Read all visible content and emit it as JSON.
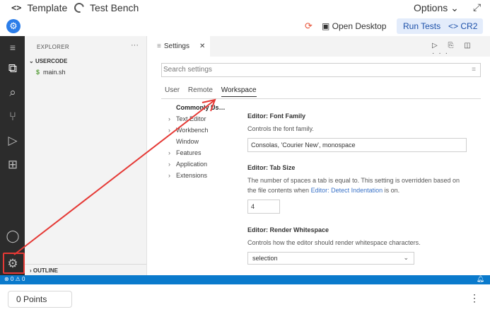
{
  "titlebar": {
    "code_glyph": "<>",
    "template_label": "Template",
    "testbench_label": "Test Bench",
    "options_label": "Options ⌄",
    "expand_glyph": "⤢"
  },
  "toolbar": {
    "open_desktop_label": "Open Desktop",
    "run_tests_label": "Run Tests",
    "cr2_label": "CR2",
    "cr2_glyph": "<>"
  },
  "explorer": {
    "title": "EXPLORER",
    "more": "···",
    "folder": "USERCODE",
    "file": "main.sh",
    "file_icon": "$",
    "outline": "OUTLINE"
  },
  "editor": {
    "tab_label": "Settings",
    "tab_close": "✕",
    "tab_actions": "▷ ⎘ ◫ ···",
    "search_placeholder": "Search settings",
    "scope_tabs": [
      "User",
      "Remote",
      "Workspace"
    ],
    "toc": {
      "commonly_used": "Commonly Us…",
      "text_editor": "Text Editor",
      "workbench": "Workbench",
      "window": "Window",
      "features": "Features",
      "application": "Application",
      "extensions": "Extensions"
    },
    "settings": {
      "font_family": {
        "category": "Editor: ",
        "name": "Font Family",
        "desc": "Controls the font family.",
        "value": "Consolas, 'Courier New', monospace"
      },
      "tab_size": {
        "category": "Editor: ",
        "name": "Tab Size",
        "desc_part1": "The number of spaces a tab is equal to. This setting is overridden based on the file contents when ",
        "desc_link": "Editor: Detect Indentation",
        "desc_part2": " is on.",
        "value": "4"
      },
      "render_whitespace": {
        "category": "Editor: ",
        "name": "Render Whitespace",
        "desc": "Controls how the editor should render whitespace characters.",
        "value": "selection"
      }
    }
  },
  "statusbar": {
    "problems": "⊗ 0 ⚠ 0",
    "bell": "♪"
  },
  "footer": {
    "points": "0 Points",
    "kebab": "⋮"
  },
  "colors": {
    "accent": "#2b7de9",
    "statusbar": "#0a7acc",
    "activity_bar": "#2c2c2c",
    "annotation_red": "#e53935"
  }
}
